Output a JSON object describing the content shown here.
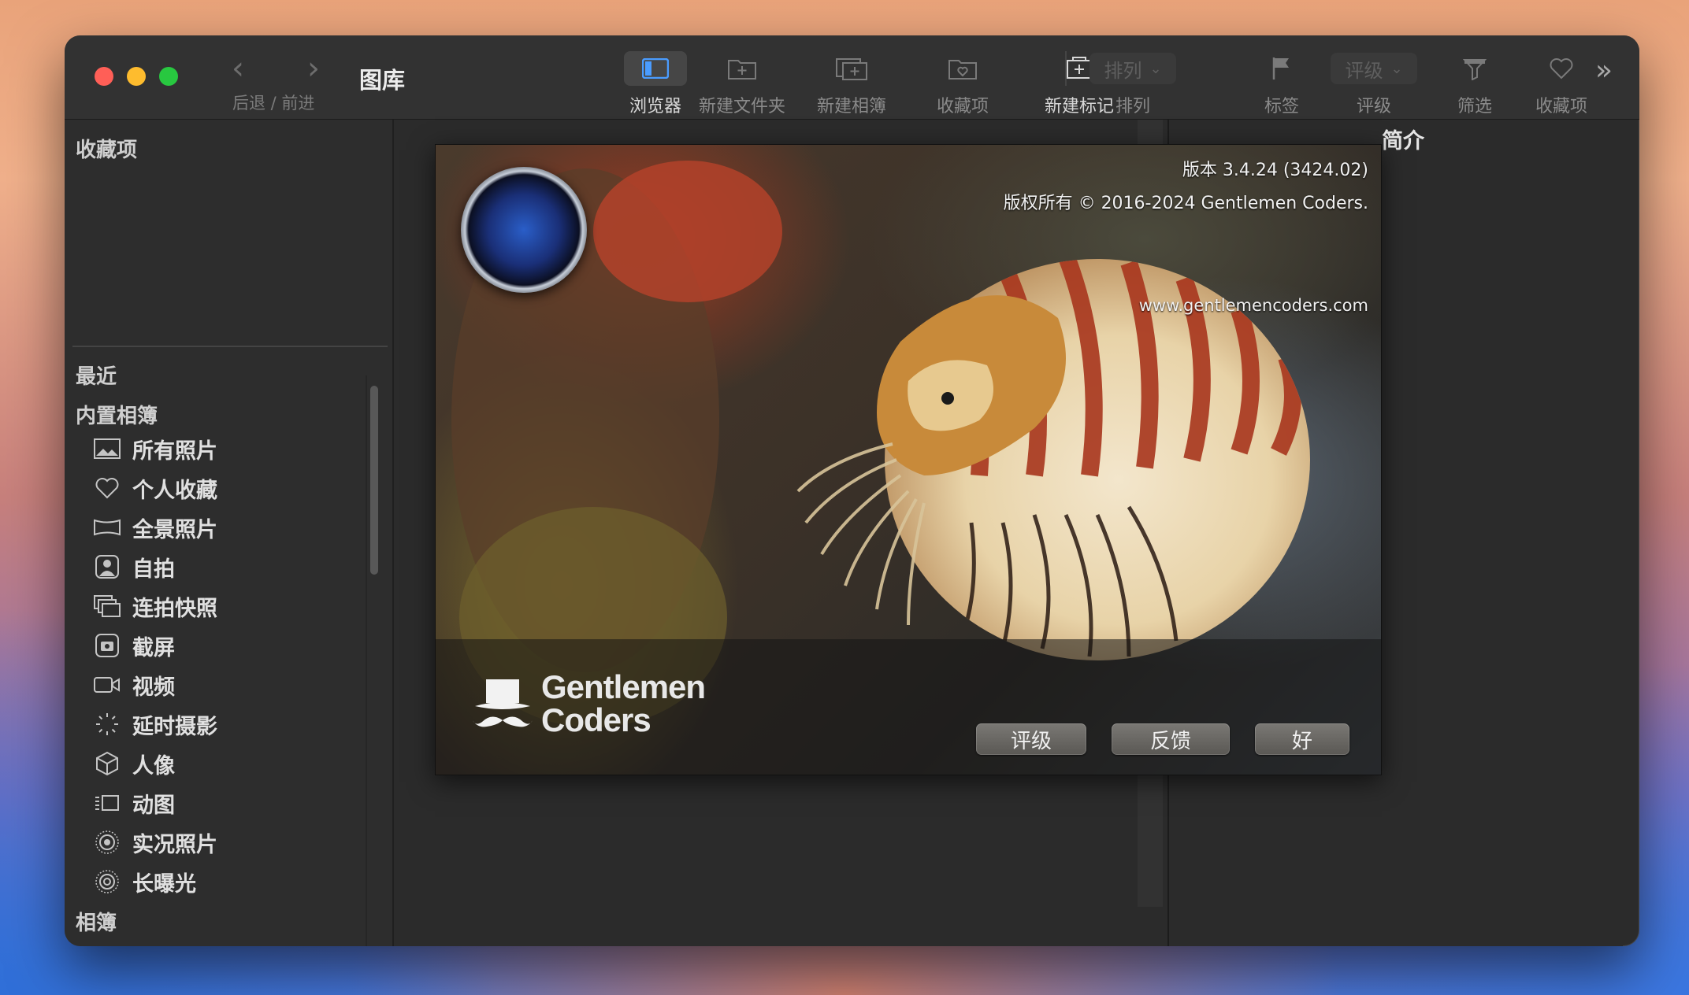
{
  "window": {
    "title": "图库"
  },
  "nav": {
    "back_forward_label": "后退 / 前进"
  },
  "toolbar": {
    "browser": "浏览器",
    "new_folder": "新建文件夹",
    "new_album": "新建相簿",
    "collect": "收藏项",
    "new_tag": "新建标记",
    "sort_popup": "排列",
    "sort": "排列",
    "label": "标签",
    "rating_popup": "评级",
    "rating": "评级",
    "filter": "筛选",
    "favorites": "收藏项"
  },
  "sidebar": {
    "favorites_header": "收藏项",
    "recent": "最近",
    "builtin_header": "内置相簿",
    "items": [
      {
        "label": "所有照片",
        "icon": "photos-icon"
      },
      {
        "label": "个人收藏",
        "icon": "heart-icon"
      },
      {
        "label": "全景照片",
        "icon": "panorama-icon"
      },
      {
        "label": "自拍",
        "icon": "selfie-icon"
      },
      {
        "label": "连拍快照",
        "icon": "burst-icon"
      },
      {
        "label": "截屏",
        "icon": "screenshot-icon"
      },
      {
        "label": "视频",
        "icon": "video-icon"
      },
      {
        "label": "延时摄影",
        "icon": "timelapse-icon"
      },
      {
        "label": "人像",
        "icon": "portrait-cube-icon"
      },
      {
        "label": "动图",
        "icon": "animated-icon"
      },
      {
        "label": "实况照片",
        "icon": "live-photo-icon"
      },
      {
        "label": "长曝光",
        "icon": "long-exposure-icon"
      }
    ],
    "albums_header": "相簿"
  },
  "info_panel": {
    "title": "简介"
  },
  "about": {
    "version": "版本 3.4.24 (3424.02)",
    "copyright": "版权所有 © 2016-2024 Gentlemen Coders.",
    "website": "www.gentlemencoders.com",
    "logo_line1": "Gentlemen",
    "logo_line2": "Coders",
    "buttons": {
      "rate": "评级",
      "feedback": "反馈",
      "ok": "好"
    }
  }
}
